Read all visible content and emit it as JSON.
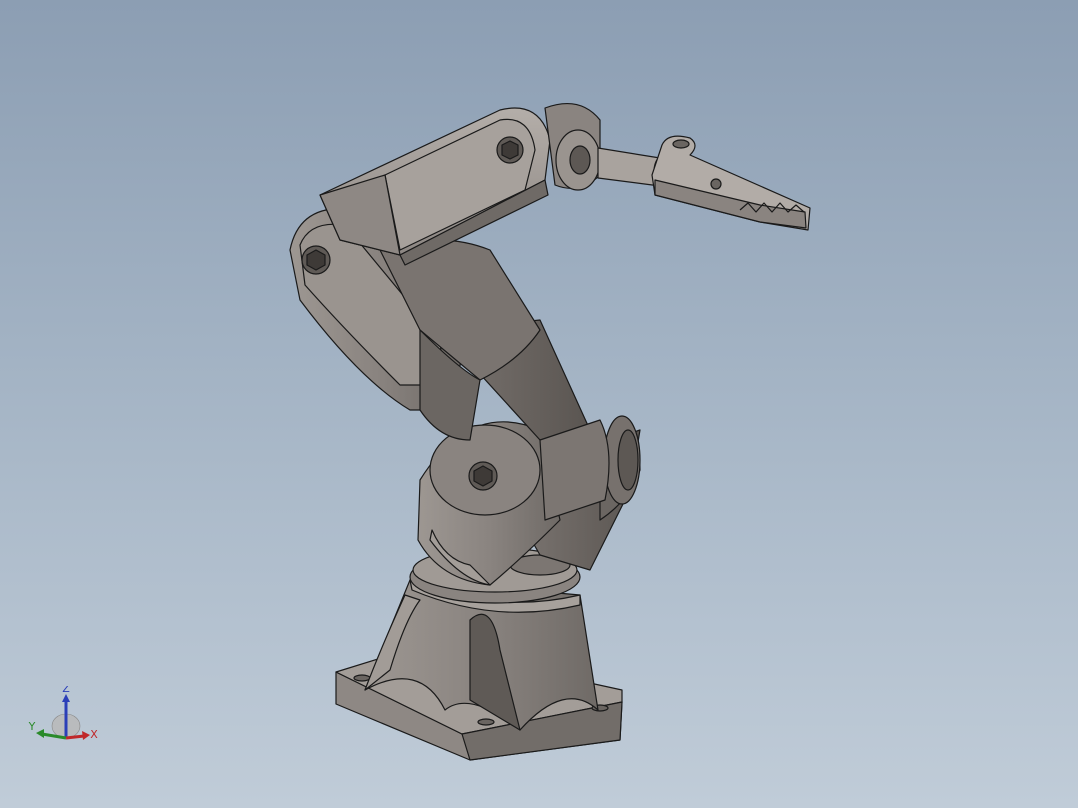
{
  "viewport": {
    "background_top": "#8c9eb3",
    "background_bottom": "#c0ccd8"
  },
  "model": {
    "description_icon": "robot-arm-model",
    "part_color": "#8a8480",
    "edge_color": "#1a1a1a"
  },
  "triad": {
    "z_label": "Z",
    "y_label": "Y",
    "x_label": "X",
    "z_color": "#2b3fb8",
    "y_color": "#2a8a2a",
    "x_color": "#c0282a"
  }
}
